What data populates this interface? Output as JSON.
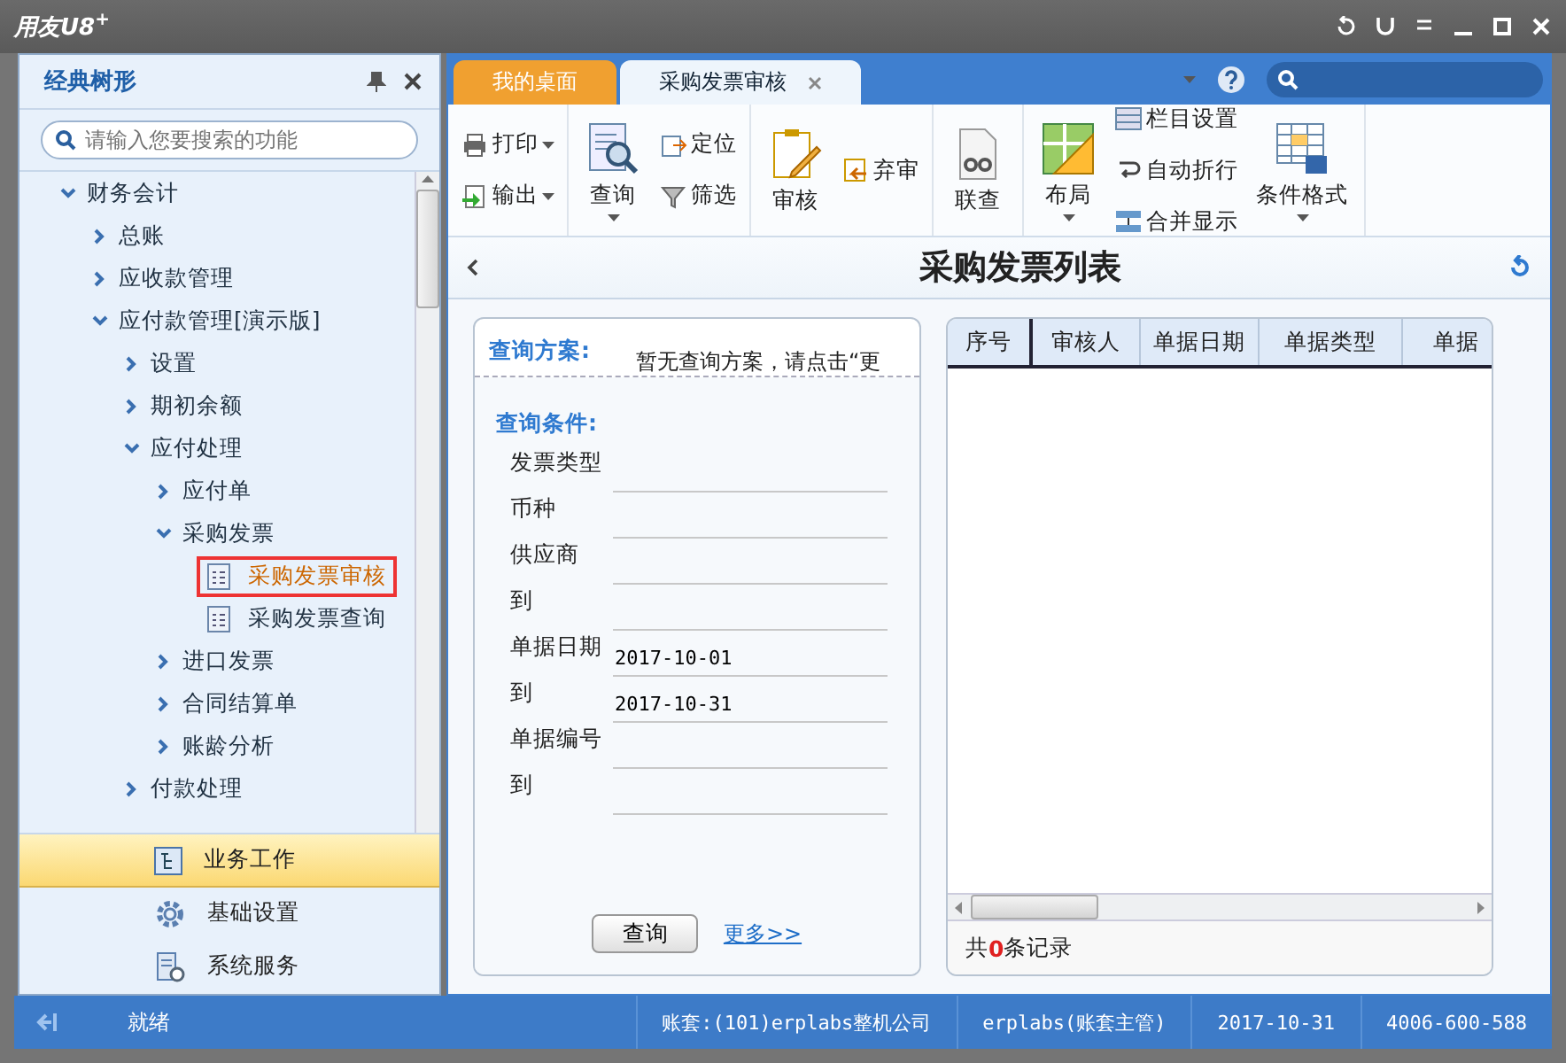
{
  "window": {
    "title": "用友U8$^{+}$"
  },
  "sidebar": {
    "title": "经典树形",
    "search": {
      "placeholder": "请输入您要搜索的功能"
    },
    "tree": [
      {
        "label": "财务会计",
        "kind": "folder",
        "expanded": true,
        "children": [
          {
            "label": "总账",
            "kind": "folder",
            "expanded": false
          },
          {
            "label": "应收款管理",
            "kind": "folder",
            "expanded": false
          },
          {
            "label": "应付款管理[演示版]",
            "kind": "folder",
            "expanded": true,
            "children": [
              {
                "label": "设置",
                "kind": "folder",
                "expanded": false
              },
              {
                "label": "期初余额",
                "kind": "folder",
                "expanded": false
              },
              {
                "label": "应付处理",
                "kind": "folder",
                "expanded": true,
                "children": [
                  {
                    "label": "应付单",
                    "kind": "folder",
                    "expanded": false
                  },
                  {
                    "label": "采购发票",
                    "kind": "folder",
                    "expanded": true,
                    "children": [
                      {
                        "label": "采购发票审核",
                        "kind": "leaf",
                        "selected": true
                      },
                      {
                        "label": "采购发票查询",
                        "kind": "leaf",
                        "selected": false
                      }
                    ]
                  },
                  {
                    "label": "进口发票",
                    "kind": "folder",
                    "expanded": false
                  },
                  {
                    "label": "合同结算单",
                    "kind": "folder",
                    "expanded": false
                  },
                  {
                    "label": "账龄分析",
                    "kind": "folder",
                    "expanded": false
                  }
                ]
              },
              {
                "label": "付款处理",
                "kind": "folder",
                "expanded": false
              }
            ]
          }
        ]
      }
    ],
    "nav": [
      {
        "label": "业务工作",
        "kind": "work",
        "selected": true
      },
      {
        "label": "基础设置",
        "kind": "settings",
        "selected": false
      },
      {
        "label": "系统服务",
        "kind": "service",
        "selected": false
      }
    ]
  },
  "tabs": [
    {
      "label": "我的桌面",
      "selected": false
    },
    {
      "label": "采购发票审核",
      "selected": true
    }
  ],
  "toolbar": [
    [
      {
        "label": "打印",
        "kind": "small",
        "dropdown": true
      },
      {
        "label": "输出",
        "kind": "small",
        "dropdown": true
      }
    ],
    [
      {
        "label": "查询",
        "kind": "large",
        "dropdown": true
      },
      {
        "label": "定位",
        "kind": "small",
        "dropdown": false
      },
      {
        "label": "筛选",
        "kind": "small",
        "dropdown": false
      }
    ],
    [
      {
        "label": "审核",
        "kind": "large",
        "dropdown": false
      },
      {
        "label": "弃审",
        "kind": "small",
        "dropdown": false
      }
    ],
    [
      {
        "label": "联查",
        "kind": "large",
        "dropdown": false
      }
    ],
    [
      {
        "label": "布局",
        "kind": "large",
        "dropdown": true
      },
      {
        "label": "栏目设置",
        "kind": "small",
        "dropdown": false
      },
      {
        "label": "自动折行",
        "kind": "small",
        "dropdown": false
      },
      {
        "label": "合并显示",
        "kind": "small",
        "dropdown": false
      },
      {
        "label": "条件格式",
        "kind": "large",
        "dropdown": true
      }
    ]
  ],
  "page_title": "采购发票列表",
  "query": {
    "scheme_label": "查询方案:",
    "scheme_text": "暂无查询方案，请点击“更",
    "conditions_label": "查询条件:",
    "fields": [
      {
        "label": "发票类型"
      },
      {
        "label": "币种"
      },
      {
        "label": "供应商"
      },
      {
        "label": "到"
      },
      {
        "label": "单据日期",
        "value": "2017-10-01"
      },
      {
        "label": "到",
        "value": "2017-10-31"
      },
      {
        "label": "单据编号"
      },
      {
        "label": "到"
      }
    ],
    "query_button": "查询",
    "more_link": "更多>>"
  },
  "list": {
    "columns": [
      "序号",
      "审核人",
      "单据日期",
      "单据类型",
      "单据"
    ],
    "summary": "共**0**条记录"
  },
  "status_bar": {
    "status": "就绪",
    "account": "账套:(101)erplabs整机公司",
    "user": "erplabs(账套主管)",
    "date": "2017-10-31",
    "phone": "4006-600-588"
  }
}
